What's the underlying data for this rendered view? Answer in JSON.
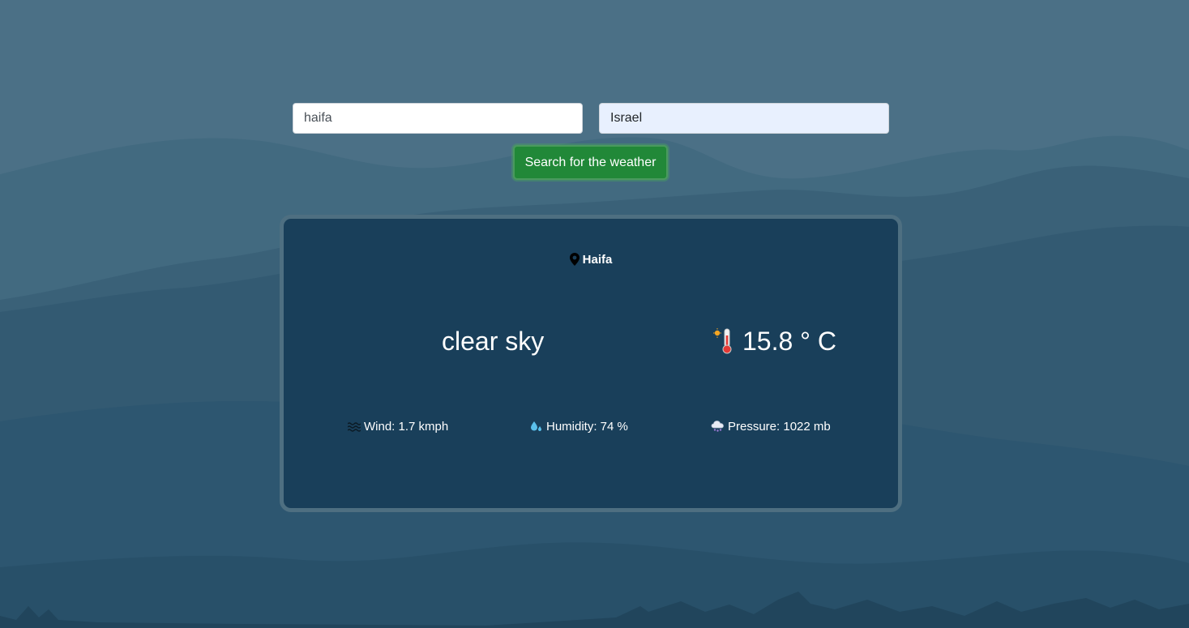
{
  "search": {
    "city_value": "haifa",
    "country_value": "Israel",
    "button_label": "Search for the weather"
  },
  "weather": {
    "city": "Haifa",
    "description": "clear sky",
    "temperature": "15.8 ° C",
    "wind": "Wind: 1.7 kmph",
    "humidity": "Humidity: 74 %",
    "pressure": "Pressure: 1022 mb"
  },
  "icons": {
    "location": "map-pin-icon",
    "temperature": "thermometer-icon",
    "wind": "wind-icon",
    "humidity": "droplet-icon",
    "pressure": "cloud-icon"
  },
  "colors": {
    "background": "#4b7086",
    "card": "#193f5a",
    "card_border": "#4e6f81",
    "button": "#218838"
  }
}
